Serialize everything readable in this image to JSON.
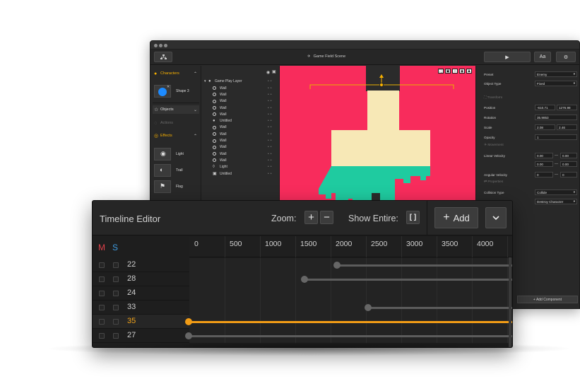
{
  "editor": {
    "scene_title": "Game Field Scene",
    "toolbar": {
      "font_button_label": "Aa"
    },
    "left_panel": {
      "characters_label": "Characters",
      "character_item": "Shape 3",
      "objects_label": "Objects",
      "actions_label": "Actions",
      "effects_label": "Effects",
      "effects": [
        "Light",
        "Trail",
        "Flag"
      ]
    },
    "hierarchy": {
      "root": "Game Play Layer",
      "items": [
        "Wall",
        "Wall",
        "Wall",
        "Wall",
        "Wall",
        "Untitled",
        "Wall",
        "Wall",
        "Wall",
        "Wall",
        "Wall",
        "Wall",
        "Light",
        "Untitled"
      ]
    },
    "inspector": {
      "preset_label": "Preset",
      "preset_value": "Enemy",
      "object_type_label": "Object Type",
      "object_type_value": "Fixed",
      "transform_section": "Transform",
      "position_label": "Position",
      "position_x": "-610.71",
      "position_y": "1276.98",
      "rotation_label": "Rotation",
      "rotation_value": "35.9853",
      "scale_label": "Scale",
      "scale_x": "2.08",
      "scale_y": "2.46",
      "opacity_label": "Opacity",
      "opacity_value": "1",
      "movement_section": "Movement",
      "linear_velocity_label": "Linear Velocity",
      "lv_x1": "0.00",
      "lv_x2": "0.00",
      "lv_y1": "0.00",
      "lv_y2": "0.00",
      "angular_velocity_label": "Angular Velocity",
      "av_1": "0",
      "av_2": "0",
      "properties_section": "Properties",
      "collision_label": "Collision Type",
      "collision_value": "Collide",
      "destroy_value": "Destroy Character",
      "add_component": "+ Add Component"
    },
    "colors": {
      "viewport_bg": "#f82c5c",
      "cream": "#f7e8b6",
      "teal": "#1fcba0",
      "accent": "#f7b000"
    }
  },
  "timeline": {
    "title": "Timeline Editor",
    "zoom_label": "Zoom:",
    "zoom_in": "+",
    "zoom_out": "−",
    "show_entire_label": "Show Entire:",
    "show_entire_icon": "[ ]",
    "add_label": "Add",
    "add_icon": "+",
    "m_label": "M",
    "s_label": "S",
    "ticks": [
      "0",
      "500",
      "1000",
      "1500",
      "2000",
      "2500",
      "3000",
      "3500",
      "4000"
    ],
    "rows": [
      {
        "id": "22",
        "start": 2100,
        "active": false
      },
      {
        "id": "28",
        "start": 1640,
        "active": false
      },
      {
        "id": "24",
        "start": 0,
        "active": false,
        "empty": true
      },
      {
        "id": "33",
        "start": 2540,
        "active": false
      },
      {
        "id": "35",
        "start": 0,
        "active": true
      },
      {
        "id": "27",
        "start": 0,
        "active": false
      }
    ],
    "accent": "#f19c16"
  }
}
